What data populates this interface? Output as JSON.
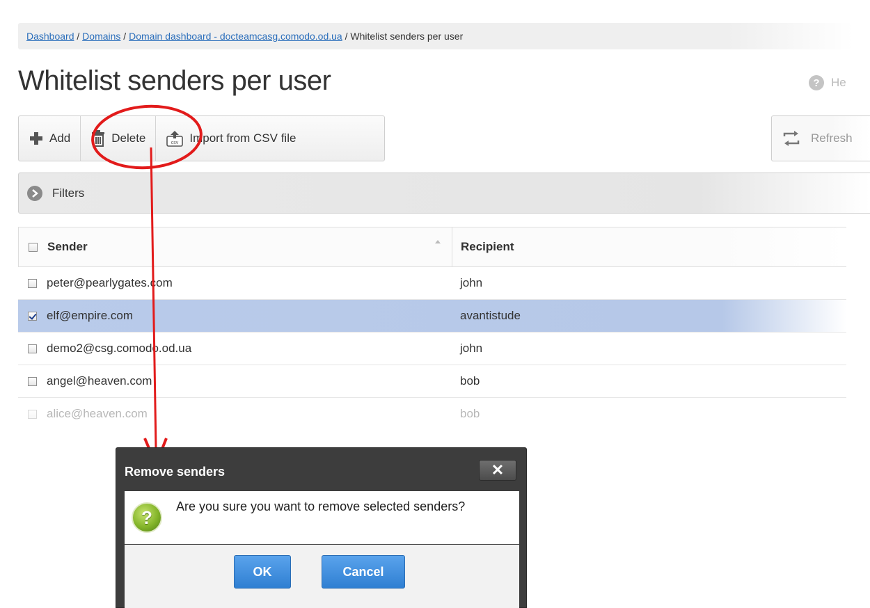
{
  "breadcrumb": {
    "dashboard": "Dashboard",
    "sep1": " / ",
    "domains": "Domains",
    "sep2": " / ",
    "domain_dashboard": "Domain dashboard - docteamcasg.comodo.od.ua",
    "sep3": " / ",
    "current": "Whitelist senders per user"
  },
  "page_title": "Whitelist senders per user",
  "help_label": "He",
  "toolbar": {
    "add_label": "Add",
    "delete_label": "Delete",
    "import_label": "Import from CSV file",
    "refresh_label": "Refresh"
  },
  "filters_label": "Filters",
  "table": {
    "headers": {
      "sender": "Sender",
      "recipient": "Recipient"
    },
    "rows": [
      {
        "sender": "peter@pearlygates.com",
        "recipient": "john",
        "checked": false
      },
      {
        "sender": "elf@empire.com",
        "recipient": "avantistude",
        "checked": true
      },
      {
        "sender": "demo2@csg.comodo.od.ua",
        "recipient": "john",
        "checked": false
      },
      {
        "sender": "angel@heaven.com",
        "recipient": "bob",
        "checked": false
      },
      {
        "sender": "alice@heaven.com",
        "recipient": "bob",
        "checked": false
      }
    ]
  },
  "dialog": {
    "title": "Remove senders",
    "close_glyph": "✕",
    "question_glyph": "?",
    "message": "Are you sure you want to remove selected senders?",
    "ok_label": "OK",
    "cancel_label": "Cancel"
  },
  "colors": {
    "annotation": "#e21b1b",
    "selected_row": "#b9cbea",
    "dialog_button": "#3f8fdf",
    "link": "#2a6ebb"
  }
}
